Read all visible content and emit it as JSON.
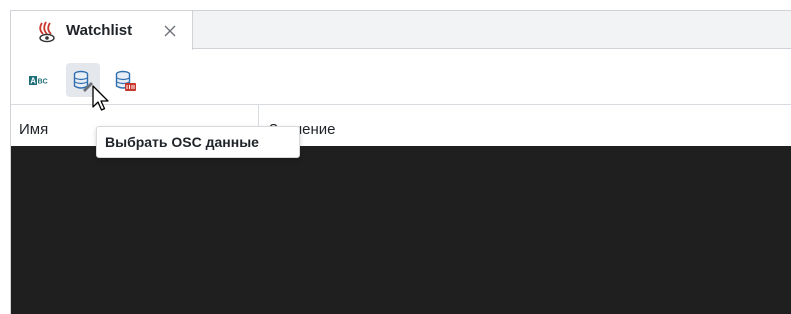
{
  "tab": {
    "title": "Watchlist",
    "icon": "watchlist-eye-icon",
    "close_icon": "close-icon"
  },
  "toolbar": {
    "buttons": [
      {
        "name": "abc-toggle-button",
        "icon": "abc-icon",
        "badge": "ABC"
      },
      {
        "name": "select-osc-data-button",
        "icon": "database-edit-icon",
        "state": "hover"
      },
      {
        "name": "clear-osc-data-button",
        "icon": "database-clear-icon"
      }
    ]
  },
  "table": {
    "columns": [
      "Имя",
      "Значение"
    ],
    "rows": []
  },
  "tooltip": {
    "text": "Выбрать OSC данные"
  },
  "colors": {
    "accent_red": "#c8372d",
    "accent_blue": "#2f6fb0",
    "accent_teal": "#1f6f78",
    "table_body_bg": "#1f1f1f",
    "tabstrip_bg": "#f2f3f5"
  }
}
